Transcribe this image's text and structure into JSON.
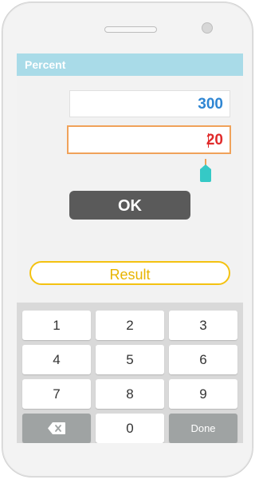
{
  "screen": {
    "title": "Percent"
  },
  "inputs": {
    "value": "300",
    "percent": "20"
  },
  "buttons": {
    "ok_label": "OK",
    "result_label": "Result"
  },
  "keypad": {
    "keys": [
      "1",
      "2",
      "3",
      "4",
      "5",
      "6",
      "7",
      "8",
      "9",
      "0"
    ],
    "done_label": "Done",
    "backspace_icon": "backspace-icon"
  },
  "colors": {
    "title_bar": "#a9dbe8",
    "value_text": "#2f86d3",
    "percent_text": "#e02b2b",
    "percent_border": "#f0a25a",
    "ok_button": "#5a5a5a",
    "result_border": "#f4c211"
  }
}
